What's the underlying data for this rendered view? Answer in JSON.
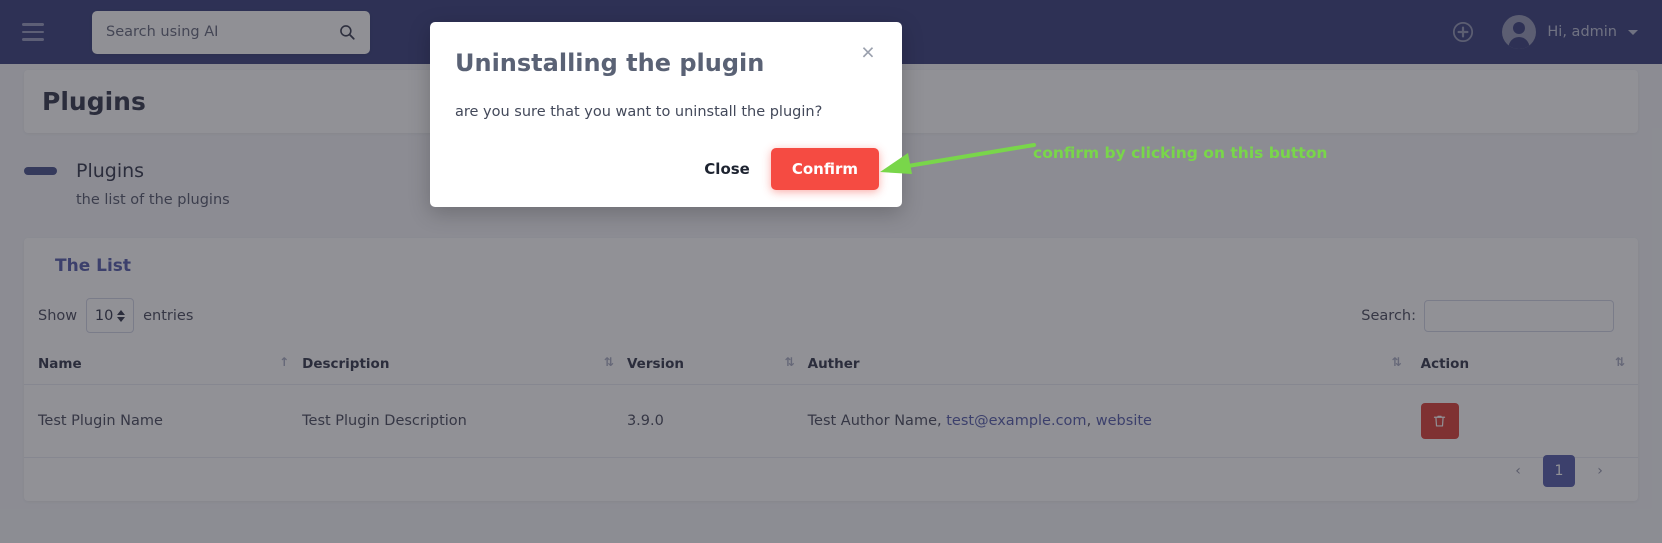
{
  "navbar": {
    "menu_icon": "hamburger-icon",
    "search": {
      "placeholder": "Search using AI",
      "value": "",
      "icon": "search-icon"
    },
    "add_icon": "plus-circle-icon",
    "user_label": "Hi, admin",
    "user_avatar": "avatar-icon",
    "caret_icon": "chevron-down-icon"
  },
  "page": {
    "title": "Plugins",
    "section_title": "Plugins",
    "section_subtitle": "the list of the plugins"
  },
  "table_card": {
    "title": "The List",
    "show_label": "Show",
    "entries_label": "entries",
    "page_length": "10",
    "search_label": "Search:",
    "search_value": "",
    "search_placeholder": "",
    "columns": [
      {
        "label": "Name",
        "sort_icon": "sort-asc-icon"
      },
      {
        "label": "Description",
        "sort_icon": "sort-both-icon"
      },
      {
        "label": "Version",
        "sort_icon": "sort-both-icon"
      },
      {
        "label": "Auther",
        "sort_icon": "sort-both-icon"
      },
      {
        "label": "Action",
        "sort_icon": "sort-both-icon"
      }
    ],
    "rows": [
      {
        "name": "Test Plugin Name",
        "description": "Test Plugin Description",
        "version": "3.9.0",
        "author_name": "Test Author Name,",
        "author_email": "test@example.com",
        "author_sep": ",",
        "author_website": "website",
        "action_icon": "trash-icon"
      }
    ],
    "pagination": {
      "prev": "‹",
      "pages": [
        "1"
      ],
      "next": "›",
      "current": "1"
    }
  },
  "modal": {
    "title": "Uninstalling the plugin",
    "body": "are you sure that you want to uninstall the plugin?",
    "close_icon": "close-icon",
    "close_button": "Close",
    "confirm_button": "Confirm"
  },
  "annotation": {
    "text": "confirm by clicking on this button",
    "arrow": "arrow-left-icon",
    "color": "#79d64a"
  },
  "colors": {
    "navbar": "#2d3475",
    "accent": "#4b54a6",
    "danger": "#d9342b",
    "confirm": "#f54b42",
    "annotation": "#79d64a"
  }
}
